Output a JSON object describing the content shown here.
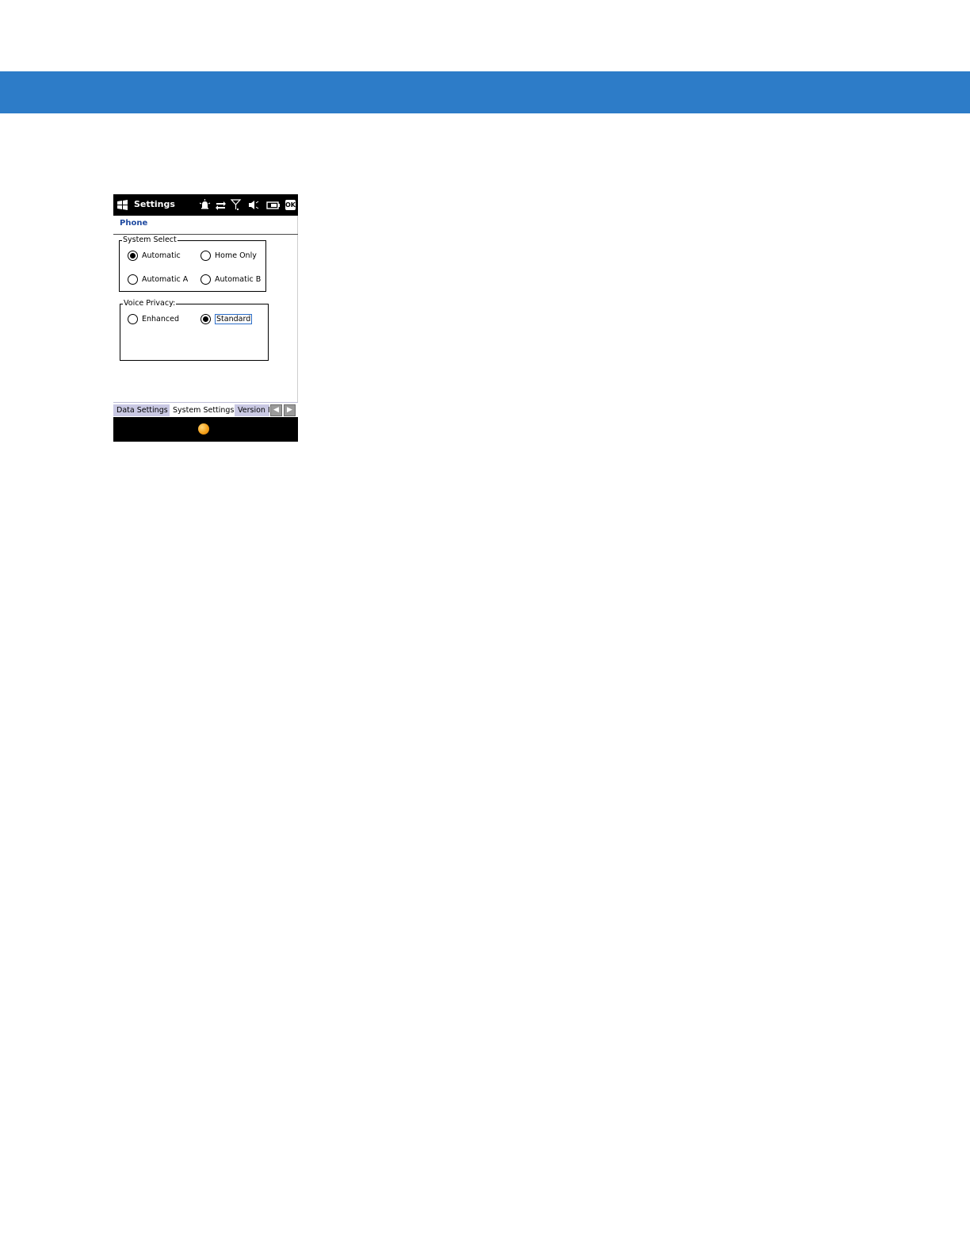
{
  "titlebar": {
    "app_title": "Settings",
    "ok_label": "OK",
    "icons": [
      "windows-start-icon",
      "notification-icon",
      "data-connection-icon",
      "signal-icon",
      "speaker-muted-icon",
      "battery-icon"
    ]
  },
  "header": {
    "title": "Phone"
  },
  "system_select": {
    "legend": "System Select",
    "options": [
      {
        "label": "Automatic",
        "checked": true
      },
      {
        "label": "Home Only",
        "checked": false
      },
      {
        "label": "Automatic A",
        "checked": false
      },
      {
        "label": "Automatic B",
        "checked": false
      }
    ]
  },
  "voice_privacy": {
    "legend": "Voice Privacy:",
    "options": [
      {
        "label": "Enhanced",
        "checked": false
      },
      {
        "label": "Standard",
        "checked": true
      }
    ]
  },
  "tabs": [
    {
      "label": "Data Settings",
      "active": false
    },
    {
      "label": "System Settings",
      "active": true
    },
    {
      "label": "Version I",
      "active": false
    }
  ],
  "colors": {
    "page_band": "#2d7cc8",
    "header_text": "#1f4aa0",
    "inactive_tab": "#c9c8e3"
  }
}
